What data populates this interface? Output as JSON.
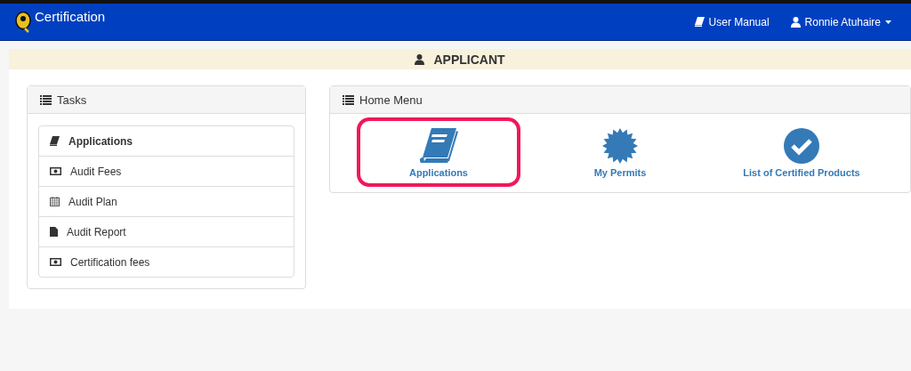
{
  "navbar": {
    "brand": "Certification",
    "links": [
      {
        "label": "User Manual"
      },
      {
        "label": "Ronnie Atuhaire",
        "dropdown": true
      }
    ]
  },
  "banner": {
    "title": "APPLICANT"
  },
  "tasks": {
    "title": "Tasks",
    "items": [
      {
        "label": "Applications",
        "selected": true
      },
      {
        "label": "Audit Fees",
        "selected": false
      },
      {
        "label": "Audit Plan",
        "selected": false
      },
      {
        "label": "Audit Report",
        "selected": false
      },
      {
        "label": "Certification fees",
        "selected": false
      }
    ]
  },
  "home_menu": {
    "title": "Home Menu",
    "tiles": [
      {
        "label": "Applications",
        "highlighted": true
      },
      {
        "label": "My Permits",
        "highlighted": false
      },
      {
        "label": "List of Certified Products",
        "highlighted": false
      }
    ]
  }
}
